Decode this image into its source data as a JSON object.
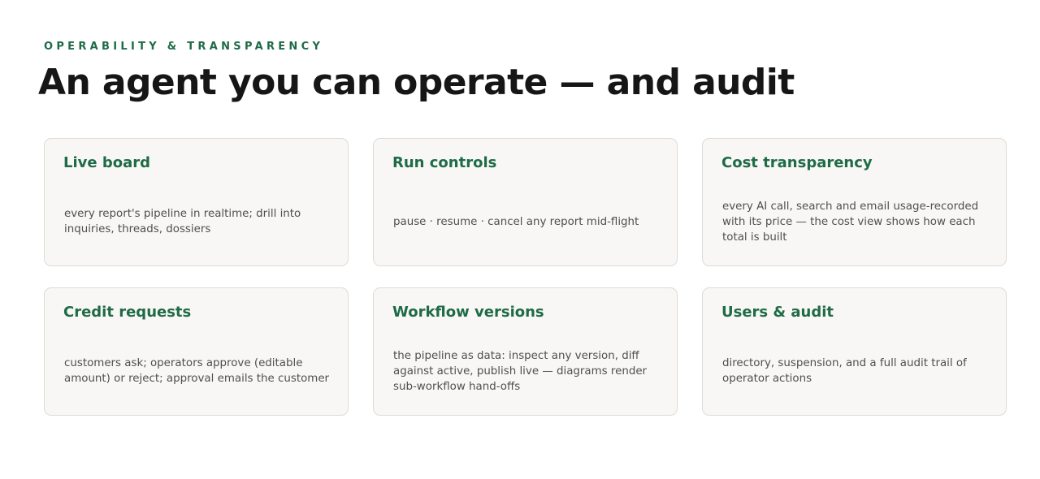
{
  "header": {
    "eyebrow": "OPERABILITY & TRANSPARENCY",
    "title": "An agent you can operate — and audit"
  },
  "cards": [
    {
      "title": "Live board",
      "description": "every report's pipeline in realtime; drill into inquiries, threads, dossiers"
    },
    {
      "title": "Run controls",
      "description": "pause · resume · cancel any report mid-flight"
    },
    {
      "title": "Cost transparency",
      "description": "every AI call, search and email usage-recorded with its price — the cost view shows how each total is built"
    },
    {
      "title": "Credit requests",
      "description": "customers ask; operators approve (editable amount) or reject; approval emails the customer"
    },
    {
      "title": "Workflow versions",
      "description": "the pipeline as data: inspect any version, diff against active, publish live — diagrams render sub-workflow hand-offs"
    },
    {
      "title": "Users & audit",
      "description": "directory, suspension, and a full audit trail of operator actions"
    }
  ],
  "colors": {
    "accent": "#1f6b47",
    "heading": "#161616",
    "body_text": "#4f4f4f",
    "card_background": "#f8f7f5",
    "card_border": "#dedbd6"
  }
}
